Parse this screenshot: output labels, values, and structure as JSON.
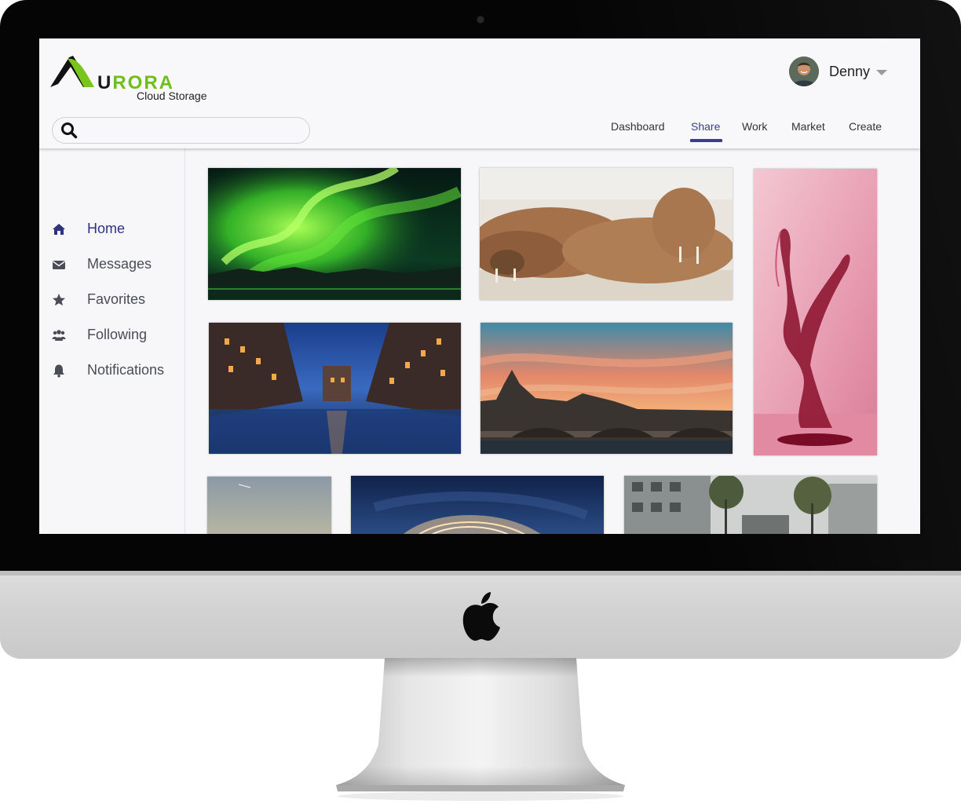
{
  "brand": {
    "logo_letter": "U",
    "logo_rest": "RORA",
    "subtitle": "Cloud Storage"
  },
  "user": {
    "name": "Denny"
  },
  "search": {
    "placeholder": ""
  },
  "nav": {
    "items": [
      {
        "label": "Dashboard",
        "active": false
      },
      {
        "label": "Share",
        "active": true
      },
      {
        "label": "Work",
        "active": false
      },
      {
        "label": "Market",
        "active": false
      },
      {
        "label": "Create",
        "active": false
      }
    ]
  },
  "sidebar": {
    "items": [
      {
        "label": "Home",
        "icon": "home-icon",
        "active": true
      },
      {
        "label": "Messages",
        "icon": "envelope-icon",
        "active": false
      },
      {
        "label": "Favorites",
        "icon": "star-icon",
        "active": false
      },
      {
        "label": "Following",
        "icon": "users-icon",
        "active": false
      },
      {
        "label": "Notifications",
        "icon": "bell-icon",
        "active": false
      }
    ]
  },
  "gallery": {
    "photos": [
      "aurora-photo",
      "walrus-photo",
      "wine-splash-photo",
      "canal-photo",
      "paris-bridge-photo",
      "sky-photo",
      "steel-wool-photo",
      "street-photo"
    ]
  },
  "colors": {
    "accent": "#3b3e8c",
    "logo_green": "#6fbf1a",
    "sidebar_active": "#2f3283",
    "sidebar_text": "#4a4d57"
  }
}
